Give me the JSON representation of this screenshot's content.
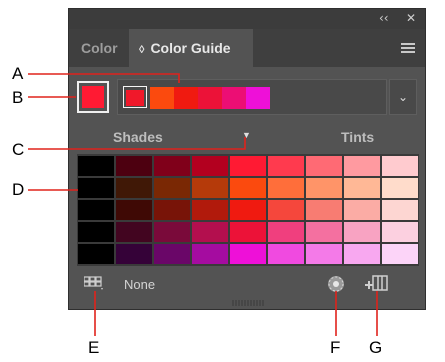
{
  "window": {
    "collapse_glyph": "‹‹",
    "close_glyph": "✕"
  },
  "tabs": [
    {
      "label": "Color",
      "active": false
    },
    {
      "label": "Color Guide",
      "active": true,
      "icon": "updown-arrows-icon"
    }
  ],
  "tab_guide_prefix": "◊",
  "menu_icon": "hamburger-menu-icon",
  "base_color": "#ff1a33",
  "harmony_colors": [
    "#f0182a",
    "#fb4a0e",
    "#f01a10",
    "#ec1238",
    "#ec0e74",
    "#ee10d8"
  ],
  "harmony_dropdown_glyph": "⌄",
  "labels": {
    "shades": "Shades",
    "tints": "Tints",
    "shade_arrow": "▼"
  },
  "variations_grid": [
    [
      "#000000",
      "#4d0010",
      "#80001a",
      "#b3001f",
      "#ff1a33",
      "#ff3a4e",
      "#ff6a74",
      "#ff9aa0",
      "#ffcbcf"
    ],
    [
      "#000000",
      "#401806",
      "#7a2804",
      "#b53a0a",
      "#fb4a0e",
      "#ff6e3a",
      "#ff9468",
      "#ffb896",
      "#ffdccb"
    ],
    [
      "#000000",
      "#3f0905",
      "#781408",
      "#b11a0c",
      "#f01a10",
      "#f5473c",
      "#f87c72",
      "#fbaca5",
      "#fdd6d2"
    ],
    [
      "#000000",
      "#420520",
      "#7a0a3a",
      "#b30f4e",
      "#ec1238",
      "#f03f7e",
      "#f470a0",
      "#f8a3c2",
      "#fcd0e0"
    ],
    [
      "#000000",
      "#350238",
      "#6a0668",
      "#a50ca0",
      "#ee10d8",
      "#f04ae0",
      "#f47ae8",
      "#f8a8f0",
      "#fcd4f8"
    ]
  ],
  "footer": {
    "grid_icon": "swatch-grid-icon",
    "none_label": "None",
    "wheel_icon": "edit-colors-wheel-icon",
    "save_icon": "save-group-to-swatches-icon"
  },
  "callouts": {
    "A": "A",
    "B": "B",
    "C": "C",
    "D": "D",
    "E": "E",
    "F": "F",
    "G": "G"
  }
}
